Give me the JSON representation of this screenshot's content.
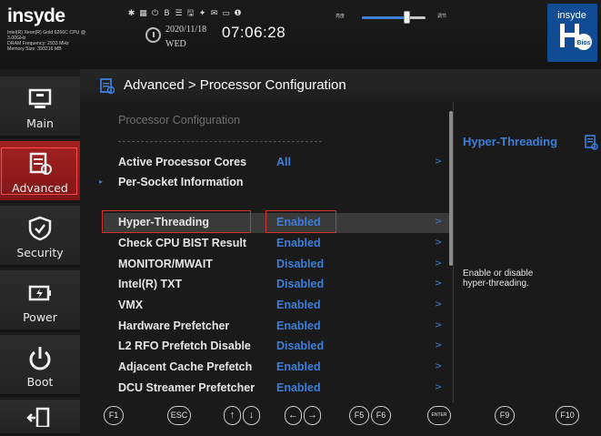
{
  "topbar": {
    "logo": "insyde",
    "sysinfo": [
      "Intel(R) Xeon(R) Gold 6266C CPU @",
      "3.00GHz",
      "DRAM Frequency: 2933 MHz",
      "Memory Size: 393216 MB"
    ],
    "toolbar_icons": [
      "pin-icon",
      "grid-icon",
      "power-icon",
      "b-icon",
      "list-icon",
      "save-icon",
      "gear-icon",
      "mail-icon",
      "monitor-icon",
      "info-icon"
    ],
    "toolbar_glyphs": [
      "✱",
      "▦",
      "⏻",
      "B",
      "☰",
      "🖫",
      "✦",
      "✉",
      "▭",
      "❶"
    ],
    "date": "2020/11/18",
    "time": "07:06:28",
    "day": "WED",
    "slider_left_label": "亮度",
    "slider_right_label": "调节",
    "slider_level": 0.7,
    "brand_logo_text": "insyde",
    "brand_logo_sub": "Bios"
  },
  "nav": {
    "items": [
      {
        "id": "main",
        "label": "Main",
        "icon": "monitor-icon"
      },
      {
        "id": "advanced",
        "label": "Advanced",
        "icon": "advanced-icon"
      },
      {
        "id": "security",
        "label": "Security",
        "icon": "shield-icon"
      },
      {
        "id": "power",
        "label": "Power",
        "icon": "battery-icon"
      },
      {
        "id": "boot",
        "label": "Boot",
        "icon": "power-icon"
      }
    ]
  },
  "header": {
    "breadcrumb": "Advanced > Processor Configuration"
  },
  "main": {
    "section_title": "Processor Configuration",
    "rows": [
      {
        "label": "Active Processor Cores",
        "value": "All",
        "arrow": ">"
      },
      {
        "label": "Per-Socket Information",
        "value": "",
        "arrow": ""
      },
      {
        "label": "Hyper-Threading",
        "value": "Enabled",
        "arrow": ">"
      },
      {
        "label": "Check CPU BIST Result",
        "value": "Enabled",
        "arrow": ">"
      },
      {
        "label": "MONITOR/MWAIT",
        "value": "Disabled",
        "arrow": ">"
      },
      {
        "label": "Intel(R) TXT",
        "value": "Disabled",
        "arrow": ">"
      },
      {
        "label": "VMX",
        "value": "Enabled",
        "arrow": ">"
      },
      {
        "label": "Hardware Prefetcher",
        "value": "Enabled",
        "arrow": ">"
      },
      {
        "label": "L2 RFO Prefetch Disable",
        "value": "Disabled",
        "arrow": ">"
      },
      {
        "label": "Adjacent Cache Prefetch",
        "value": "Enabled",
        "arrow": ">"
      },
      {
        "label": "DCU Streamer Prefetcher",
        "value": "Enabled",
        "arrow": ">"
      }
    ],
    "bullet": "▸"
  },
  "help": {
    "title": "Hyper-Threading",
    "text_line1": "Enable or disable",
    "text_line2": "hyper-threading."
  },
  "footer": {
    "keys": [
      "F1",
      "ESC",
      "↑",
      "↓",
      "←",
      "→",
      "F5",
      "F6",
      "ENTER",
      "F9",
      "F10"
    ]
  },
  "colors": {
    "accent_blue": "#3d7fd8",
    "nav_active": "#a52121",
    "highlight_red": "#d9342b"
  }
}
